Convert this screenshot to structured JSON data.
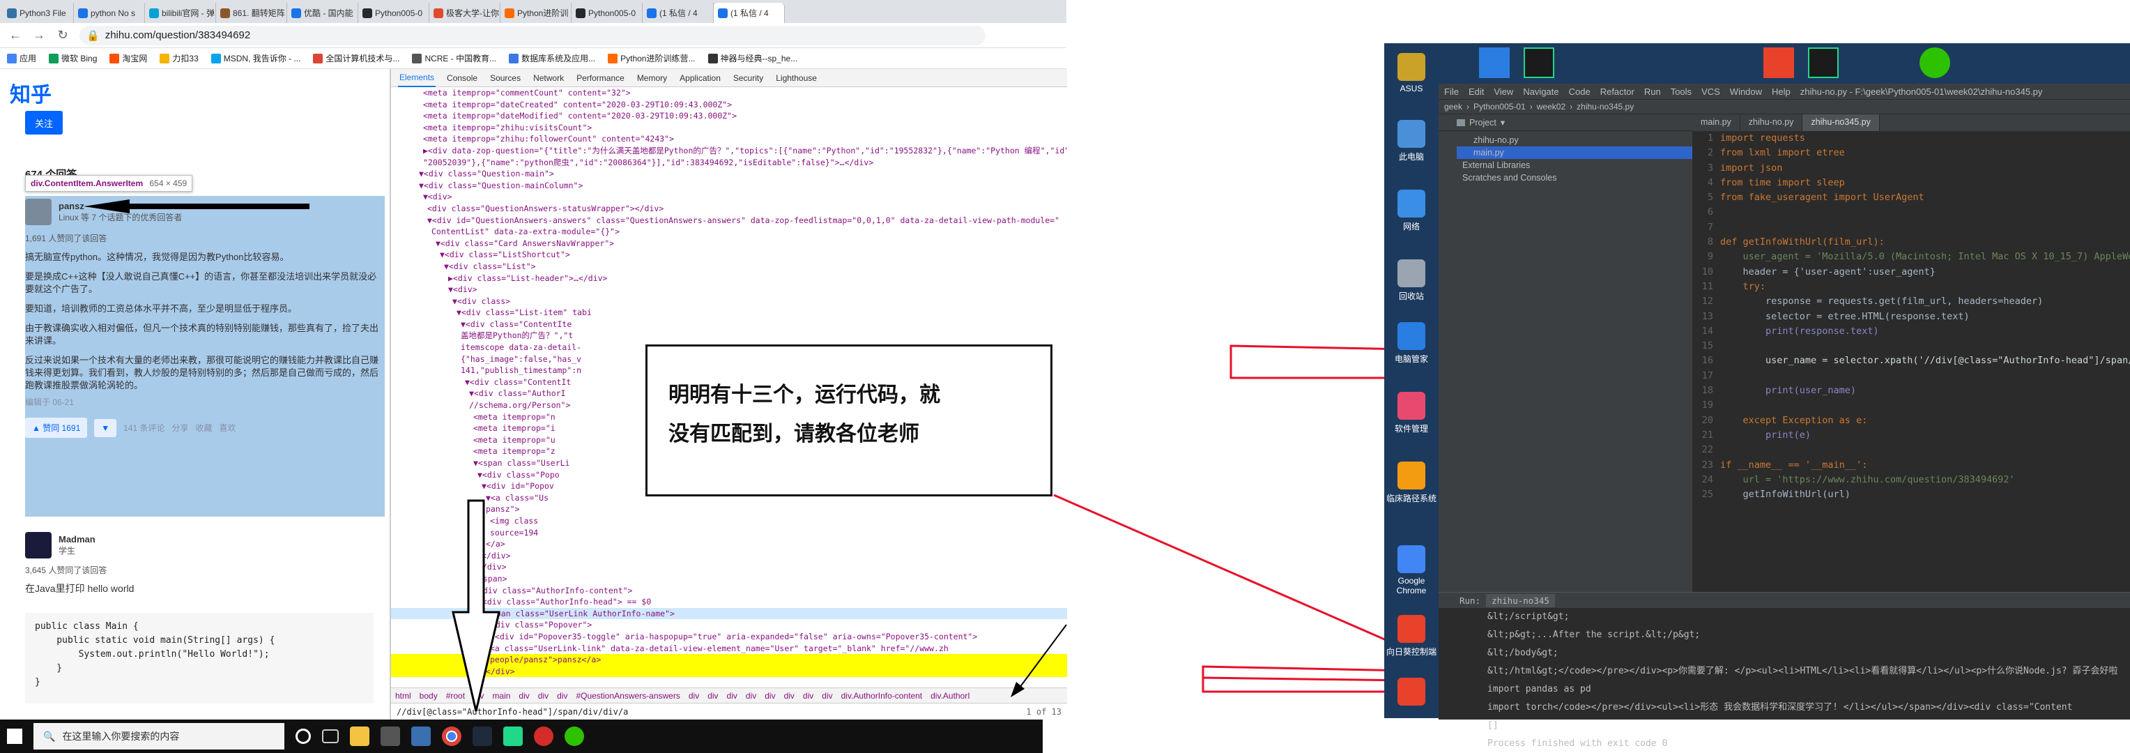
{
  "browser": {
    "tabs": [
      "Python3 File",
      "python No s",
      "bilibili官网 - 弹",
      "861. 翻转矩阵",
      "优酷 - 国内能",
      "Python005-0",
      "极客大学-让你",
      "Python进阶训",
      "Python005-0",
      "(1 私信 / 4",
      "(1 私信 / 4"
    ],
    "url": "zhihu.com/question/383494692",
    "bookmarks": [
      "应用",
      "微软 Bing",
      "淘宝网",
      "力扣33",
      "MSDN, 我告诉你 - ...",
      "全国计算机技术与...",
      "NCRE - 中国教育...",
      "数据库系统及应用...",
      "Python进阶训练营...",
      "神器与经典--sp_he..."
    ]
  },
  "zhihu": {
    "logo": "知乎",
    "follow": "关注",
    "answer_count": "674 个回答",
    "tooltip_selector": "div.ContentItem.AnswerItem",
    "tooltip_size": "654 × 459",
    "answer1": {
      "author": "pansz",
      "bio": "Linux 等 7 个话题下的优秀回答者",
      "likes": "1,691 人赞同了该回答",
      "paragraphs": [
        "搞无脑宣传python。这种情况，我觉得是因为教Python比较容易。",
        "要是换成C++这种【没人敢说自己真懂C++】的语言，你甚至都没法培训出来学员就没必要就这个广告了。",
        "要知道，培训教师的工资总体水平并不高，至少是明显低于程序员。",
        "由于教课确实收入相对偏低，但凡一个技术真的特别特别能赚钱，那些真有了，捡了夫出来讲课。",
        "反过来说如果一个技术有大量的老师出来教，那很可能说明它的赚钱能力并教课比自己赚钱来得更划算。我们看到，教人炒股的是特别特别的多；然后那是自己做而亏成的，然后跑教课推股票做涡轮涡轮的。"
      ],
      "edited": "编辑于 06-21",
      "actions": [
        "▲ 赞同 1691",
        "▼",
        "141 条评论",
        "分享",
        "收藏",
        "喜欢"
      ]
    },
    "answer2": {
      "author": "Madman",
      "bio": "学生",
      "likes": "3,645 人赞同了该回答",
      "text": "在Java里打印 hello world",
      "code": "public class Main {\n    public static void main(String[] args) {\n        System.out.println(\"Hello World!\");\n    }\n}"
    }
  },
  "devtools": {
    "tabs": [
      "Elements",
      "Console",
      "Sources",
      "Network",
      "Performance",
      "Memory",
      "Application",
      "Security",
      "Lighthouse"
    ],
    "dom_lines": [
      "<meta itemprop=\"commentCount\" content=\"32\">",
      "<meta itemprop=\"dateCreated\" content=\"2020-03-29T10:09:43.000Z\">",
      "<meta itemprop=\"dateModified\" content=\"2020-03-29T10:09:43.000Z\">",
      "<meta itemprop=\"zhihu:visitsCount\">",
      "<meta itemprop=\"zhihu:followerCount\" content=\"4243\">",
      "▶<div data-zop-question=\"{\"title\":\"为什么满天盖地都是Python的广告？\",\"topics\":[{\"name\":\"Python\",\"id\":\"19552832\"},{\"name\":\"Python 编程\",\"id\":",
      "\"20052039\"},{\"name\":\"python爬虫\",\"id\":\"20086364\"}],\"id\":383494692,\"isEditable\":false}\">…</div>",
      "▼<div class=\"Question-main\">",
      "▼<div class=\"Question-mainColumn\">",
      "▼<div>",
      "<div class=\"QuestionAnswers-statusWrapper\"></div>",
      "▼<div id=\"QuestionAnswers-answers\" class=\"QuestionAnswers-answers\" data-zop-feedlistmap=\"0,0,1,0\" data-za-detail-view-path-module=\"",
      "ContentList\" data-za-extra-module=\"{}\">",
      "▼<div class=\"Card AnswersNavWrapper\">",
      "▼<div class=\"ListShortcut\">",
      "▼<div class=\"List\">",
      "▶<div class=\"List-header\">…</div>",
      "▼<div>",
      "▼<div class>",
      "▼<div class=\"List-item\" tabi",
      "▼<div class=\"ContentIte",
      "盖地都是Python的广告？\",\"t",
      "itemscope data-za-detail-",
      "{\"has_image\":false,\"has_v",
      "141,\"publish_timestamp\":n",
      "▼<div class=\"ContentIt",
      "▼<div class=\"AuthorI",
      "//schema.org/Person\">",
      "<meta itemprop=\"n",
      "<meta itemprop=\"i",
      "<meta itemprop=\"u",
      "<meta itemprop=\"z",
      "▼<span class=\"UserLi",
      "▼<div class=\"Popo",
      "▼<div id=\"Popov",
      "▼<a class=\"Us",
      "pansz\">",
      "<img class",
      "source=194",
      "</a>",
      "</div>",
      "</div>",
      "</span>",
      "▼<div class=\"AuthorInfo-content\">",
      "▼<div class=\"AuthorInfo-head\"> == $0",
      "▼<span class=\"UserLink AuthorInfo-name\">",
      "▼<div class=\"Popover\">",
      "▼<div id=\"Popover35-toggle\" aria-haspopup=\"true\" aria-expanded=\"false\" aria-owns=\"Popover35-content\">",
      "<a class=\"UserLink-link\" data-za-detail-view-element_name=\"User\" target=\"_blank\" href=\"//www.zh",
      "people/pansz\">pansz</a>",
      "</div>"
    ],
    "breadcrumbs": [
      "html",
      "body",
      "#root",
      "div",
      "main",
      "div",
      "div",
      "div",
      "#QuestionAnswers-answers",
      "div",
      "div",
      "div",
      "div",
      "div",
      "div",
      "div",
      "div",
      "div.AuthorInfo-content",
      "div.AuthorI"
    ],
    "search_query": "//div[@class=\"AuthorInfo-head\"]/span/div/div/a",
    "search_result": "1 of 13"
  },
  "annotation": {
    "line1": "明明有十三个，运行代码，就",
    "line2": "没有匹配到，请教各位老师"
  },
  "taskbar": {
    "search_placeholder": "在这里输入你要搜索的内容"
  },
  "desktop": {
    "icons": [
      "ASUS",
      "此电脑",
      "网络",
      "回收站",
      "电脑管家",
      "软件管理",
      "临床路径系统",
      "Google Chrome",
      "向日葵控制端",
      ""
    ]
  },
  "pycharm": {
    "menu": [
      "File",
      "Edit",
      "View",
      "Navigate",
      "Code",
      "Refactor",
      "Run",
      "Tools",
      "VCS",
      "Window",
      "Help"
    ],
    "title": "zhihu-no.py - F:\\geek\\Python005-01\\week02\\zhihu-no345.py",
    "breadcrumb": [
      "geek",
      "Python005-01",
      "week02",
      "zhihu-no345.py"
    ],
    "project_label": "Project",
    "tree": [
      "zhihu-no.py",
      "main.py",
      "External Libraries",
      "Scratches and Consoles"
    ],
    "editor_tabs": [
      "main.py",
      "zhihu-no.py",
      "zhihu-no345.py"
    ],
    "code": [
      {
        "n": "1",
        "t": "import requests"
      },
      {
        "n": "2",
        "t": "from lxml import etree"
      },
      {
        "n": "3",
        "t": "import json"
      },
      {
        "n": "4",
        "t": "from time import sleep"
      },
      {
        "n": "5",
        "t": "from fake_useragent import UserAgent"
      },
      {
        "n": "6",
        "t": ""
      },
      {
        "n": "7",
        "t": ""
      },
      {
        "n": "8",
        "t": "def getInfoWithUrl(film_url):"
      },
      {
        "n": "9",
        "t": "    user_agent = 'Mozilla/5.0 (Macintosh; Intel Mac OS X 10_15_7) AppleWebK"
      },
      {
        "n": "10",
        "t": "    header = {'user-agent':user_agent}"
      },
      {
        "n": "11",
        "t": "    try:"
      },
      {
        "n": "12",
        "t": "        response = requests.get(film_url, headers=header)"
      },
      {
        "n": "13",
        "t": "        selector = etree.HTML(response.text)"
      },
      {
        "n": "14",
        "t": "        print(response.text)"
      },
      {
        "n": "15",
        "t": ""
      },
      {
        "n": "16",
        "t": "        user_name = selector.xpath('//div[@class=\"AuthorInfo-head\"]/span/"
      },
      {
        "n": "17",
        "t": ""
      },
      {
        "n": "18",
        "t": "        print(user_name)"
      },
      {
        "n": "19",
        "t": ""
      },
      {
        "n": "20",
        "t": "    except Exception as e:"
      },
      {
        "n": "21",
        "t": "        print(e)"
      },
      {
        "n": "22",
        "t": ""
      },
      {
        "n": "23",
        "t": "if __name__ == '__main__':"
      },
      {
        "n": "24",
        "t": "    url = 'https://www.zhihu.com/question/383494692'"
      },
      {
        "n": "25",
        "t": "    getInfoWithUrl(url)"
      }
    ],
    "run_tab": "zhihu-no345",
    "output": [
      "&lt;/script&gt;",
      "&lt;p&gt;...After the script.&lt;/p&gt;",
      "&lt;/body&gt;",
      "&lt;/html&gt;</code></pre></div><p>你需要了解: </p><ul><li>HTML</li><li>看看就得算</li></ul><p>什么你说Node.js? 孬子会好啦",
      "import pandas as pd",
      "import torch</code></pre></div><ul><li>形态  我会数据科学和深度学习了! </li></ul></span></div><div class=\"Content",
      "[]",
      "",
      "Process finished with exit code 0"
    ]
  }
}
